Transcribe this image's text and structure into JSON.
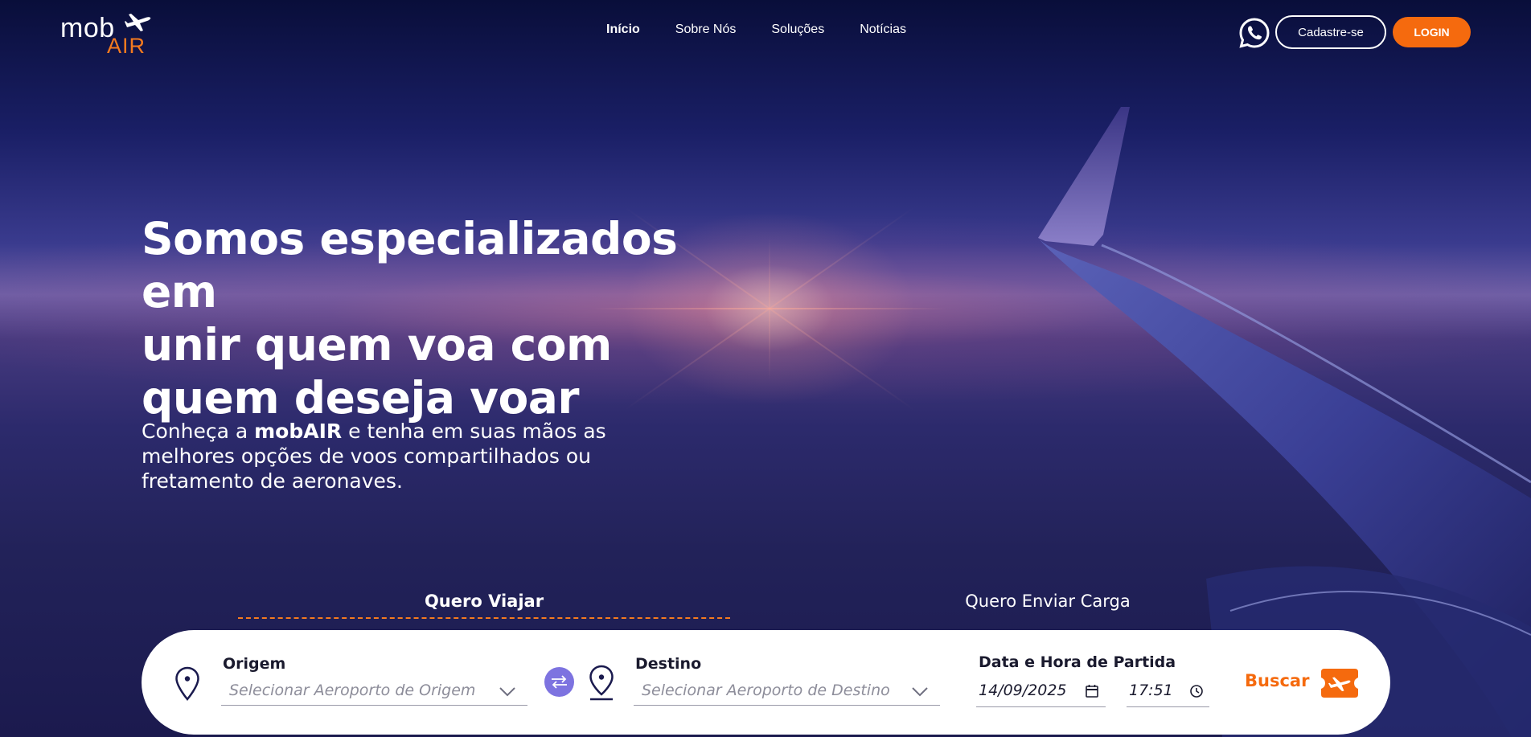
{
  "brand": {
    "logo_mob": "mob",
    "logo_air": "AIR",
    "accent": "#f56a0e",
    "navy": "#1a1a2e"
  },
  "nav": {
    "items": [
      {
        "label": "Início",
        "active": true
      },
      {
        "label": "Sobre Nós",
        "active": false
      },
      {
        "label": "Soluções",
        "active": false
      },
      {
        "label": "Notícias",
        "active": false
      }
    ]
  },
  "header": {
    "whatsapp_icon": "whatsapp-icon",
    "signup_label": "Cadastre-se",
    "login_label": "LOGIN"
  },
  "hero": {
    "headline_line1": "Somos especializados em",
    "headline_bold1": "unir quem voa",
    "headline_mid": " com ",
    "headline_bold2": "quem deseja voar",
    "sub_prefix": "Conheça a ",
    "sub_brand": "mobAIR",
    "sub_suffix": " e tenha em suas mãos as melhores opções de voos compartilhados ou fretamento de aeronaves."
  },
  "tabs": {
    "travel": "Quero Viajar",
    "cargo": "Quero Enviar Carga",
    "active": "travel"
  },
  "search": {
    "origin_label": "Origem",
    "origin_placeholder": "Selecionar Aeroporto de Origem",
    "destination_label": "Destino",
    "destination_placeholder": "Selecionar Aeroporto de Destino",
    "datetime_label": "Data e Hora de Partida",
    "date_value": "14/09/2025",
    "time_value": "17:51",
    "search_label": "Buscar",
    "swap_color": "#7d73e0"
  }
}
